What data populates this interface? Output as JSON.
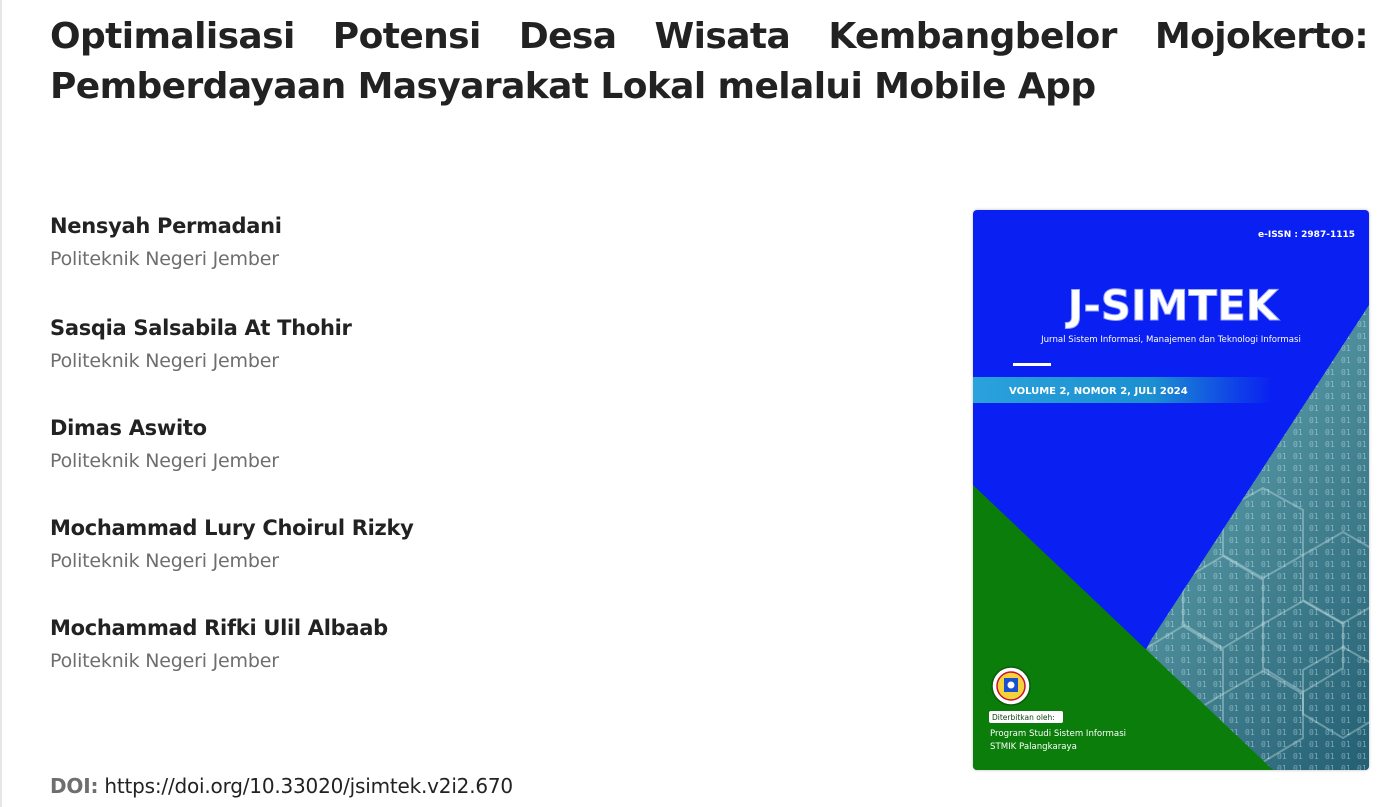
{
  "article": {
    "title": "Optimalisasi Potensi Desa Wisata Kembangbelor Mojokerto: Pemberdayaan Masyarakat Lokal melalui Mobile App"
  },
  "authors": [
    {
      "name": "Nensyah Permadani",
      "affiliation": "Politeknik Negeri Jember"
    },
    {
      "name": "Sasqia Salsabila At Thohir",
      "affiliation": "Politeknik Negeri Jember"
    },
    {
      "name": "Dimas Aswito",
      "affiliation": "Politeknik Negeri Jember"
    },
    {
      "name": "Mochammad Lury Choirul Rizky",
      "affiliation": "Politeknik Negeri Jember"
    },
    {
      "name": "Mochammad Rifki Ulil Albaab",
      "affiliation": "Politeknik Negeri Jember"
    }
  ],
  "doi": {
    "label": "DOI:",
    "url": "https://doi.org/10.33020/jsimtek.v2i2.670"
  },
  "cover": {
    "issn": "e-ISSN : 2987-1115",
    "journal_name": "J-SIMTEK",
    "journal_subtitle": "Jurnal Sistem Informasi, Manajemen dan Teknologi Informasi",
    "issue": "VOLUME 2, NOMOR 2, JULI 2024",
    "publisher_label": "Diterbitkan oleh:",
    "publisher_line1": "Program Studi Sistem Informasi",
    "publisher_line2": "STMIK Palangkaraya",
    "colors": {
      "background": "#0a1ff2",
      "triangle": "#0a7d0a",
      "tech": "#5aa0aa",
      "issue_band": "#1d8fd4"
    }
  }
}
